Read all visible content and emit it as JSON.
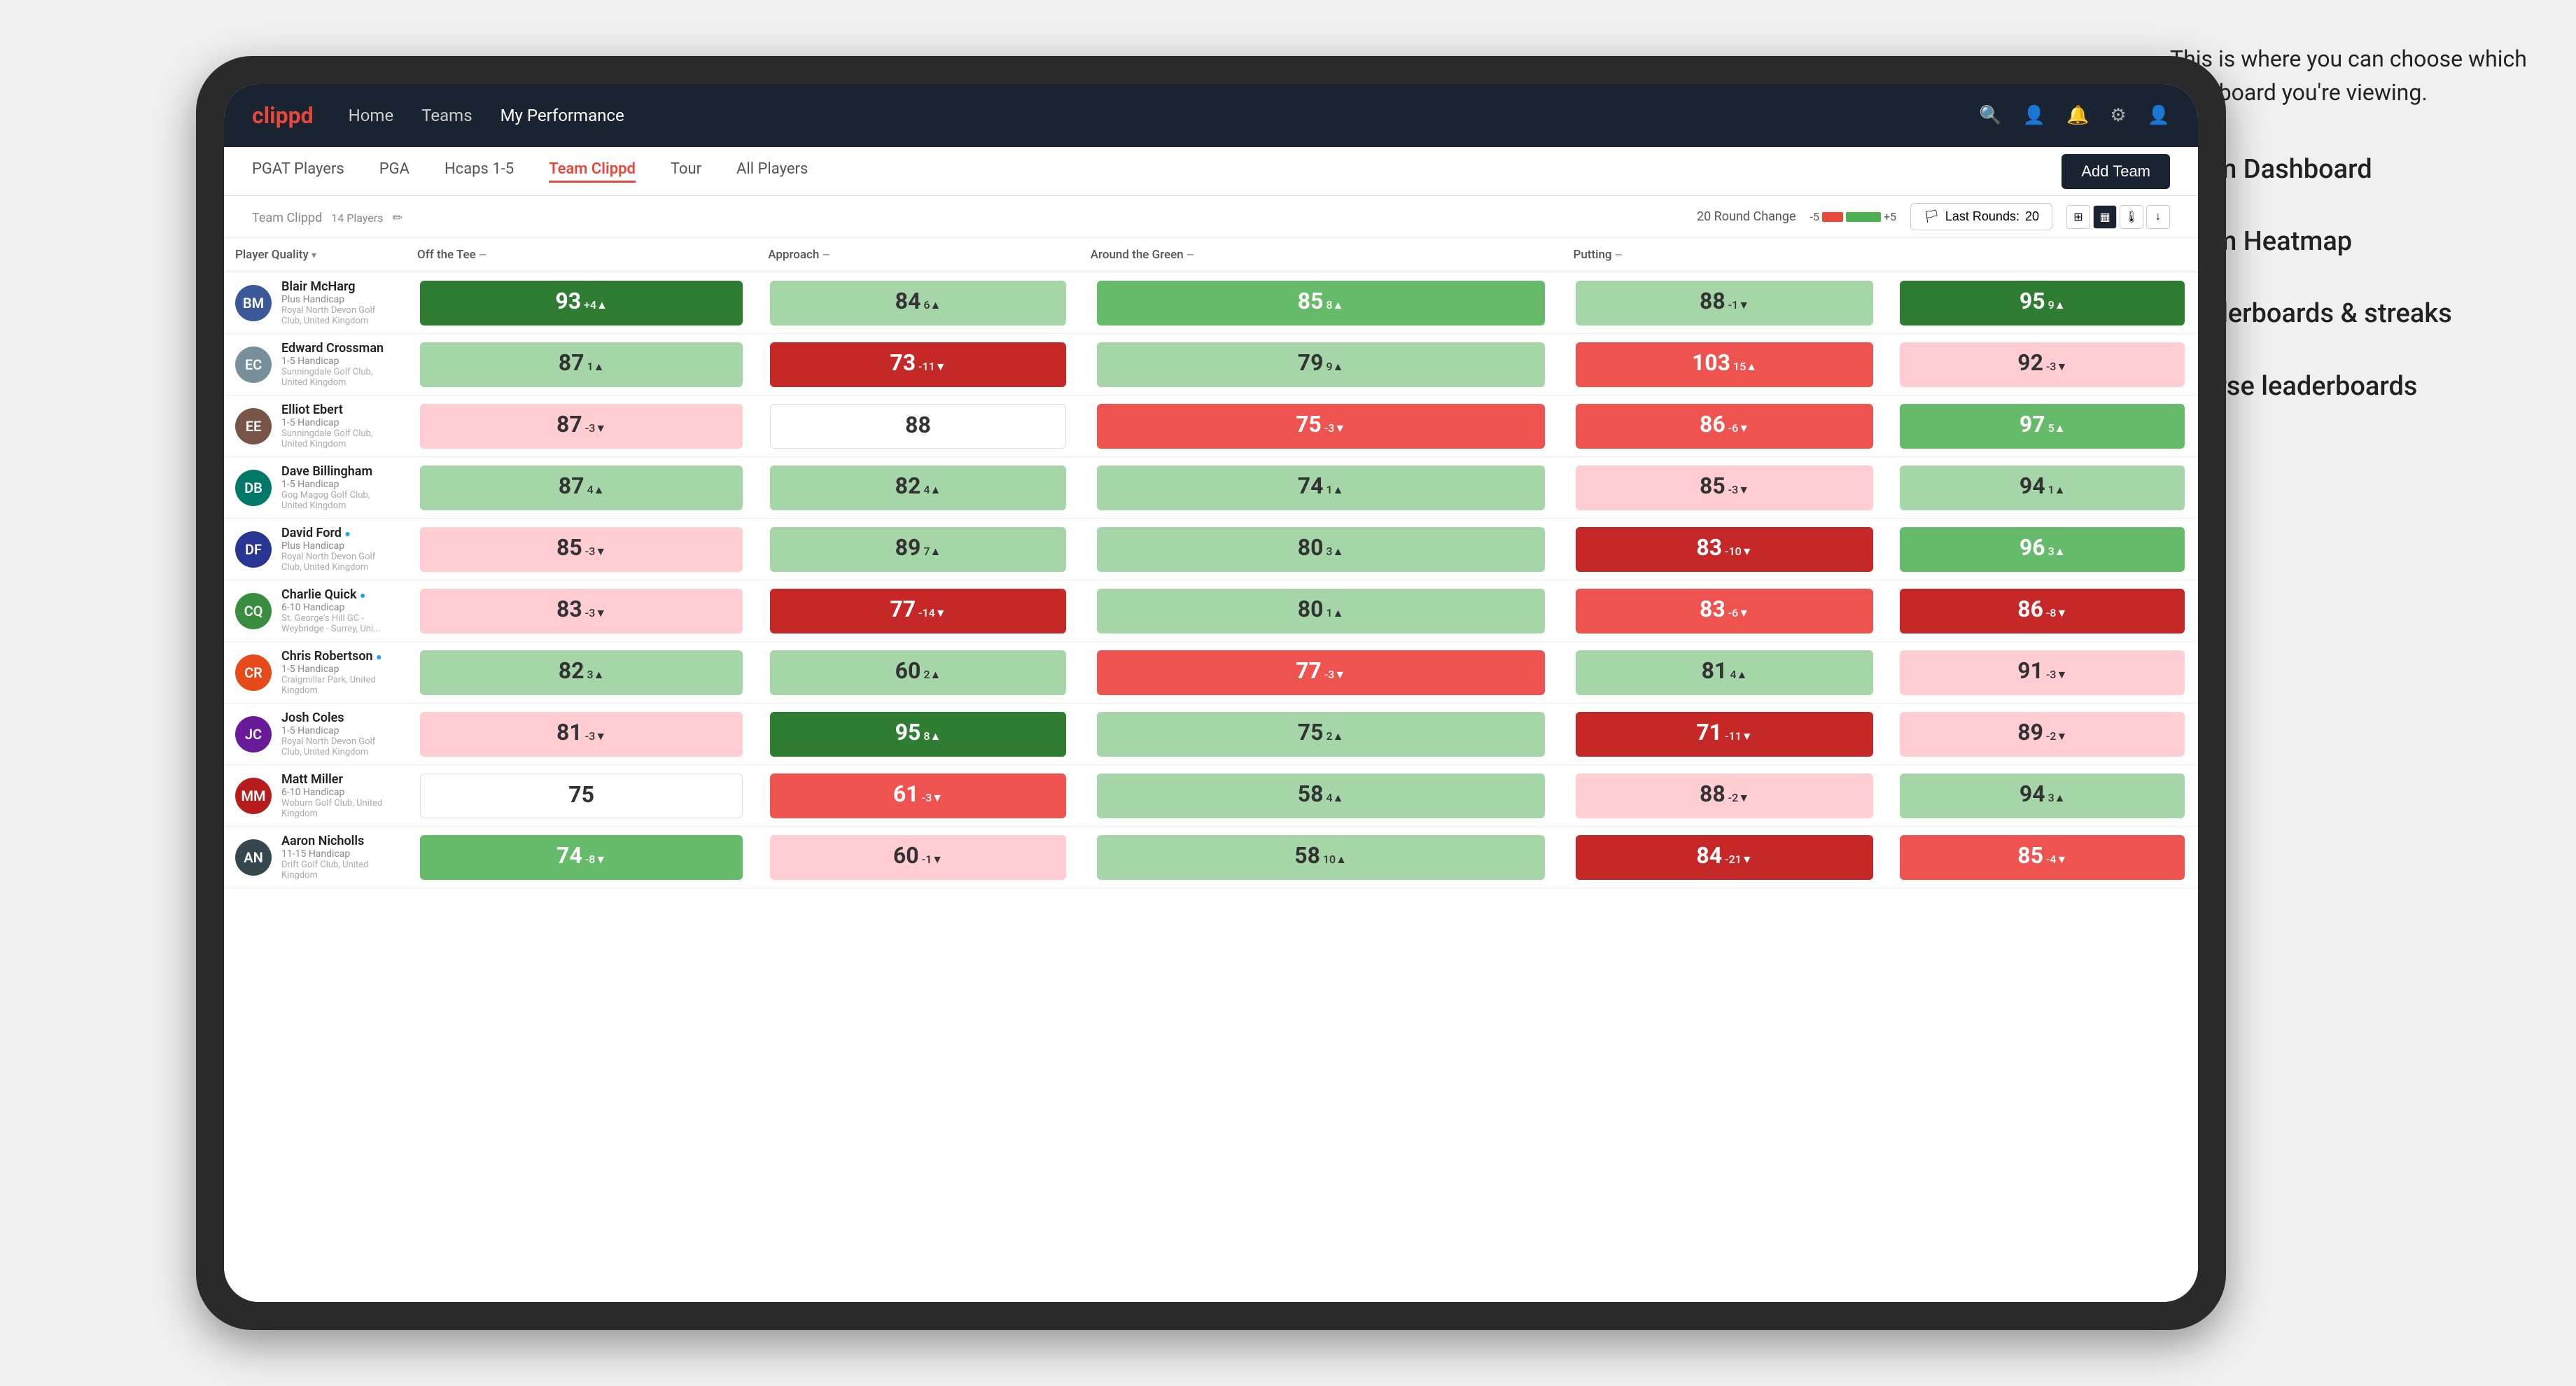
{
  "annotation": {
    "intro": "This is where you can choose which dashboard you're viewing.",
    "items": [
      "Team Dashboard",
      "Team Heatmap",
      "Leaderboards & streaks",
      "Course leaderboards"
    ]
  },
  "nav": {
    "logo": "clippd",
    "links": [
      "Home",
      "Teams",
      "My Performance"
    ],
    "active_link": "My Performance"
  },
  "sub_nav": {
    "links": [
      "PGAT Players",
      "PGA",
      "Hcaps 1-5",
      "Team Clippd",
      "Tour",
      "All Players"
    ],
    "active_link": "Team Clippd",
    "add_team_label": "Add Team"
  },
  "team_header": {
    "title": "Team Clippd",
    "player_count": "14 Players",
    "round_change_label": "20 Round Change",
    "change_min": "-5",
    "change_max": "+5",
    "last_rounds_label": "Last Rounds:",
    "last_rounds_value": "20"
  },
  "table": {
    "columns": {
      "player": "Player Quality",
      "off_tee": "Off the Tee",
      "approach": "Approach",
      "around_green": "Around the Green",
      "putting": "Putting"
    },
    "rows": [
      {
        "name": "Blair McHarg",
        "handicap": "Plus Handicap",
        "club": "Royal North Devon Golf Club, United Kingdom",
        "avatar_initials": "BM",
        "avatar_class": "av-blue",
        "player_quality": {
          "value": 93,
          "change": "+4",
          "direction": "up",
          "color": "green-dark"
        },
        "off_tee": {
          "value": 84,
          "change": "6",
          "direction": "up",
          "color": "green-light"
        },
        "approach": {
          "value": 85,
          "change": "8",
          "direction": "up",
          "color": "green-mid"
        },
        "around_green": {
          "value": 88,
          "change": "-1",
          "direction": "down",
          "color": "green-light"
        },
        "putting": {
          "value": 95,
          "change": "9",
          "direction": "up",
          "color": "green-dark"
        }
      },
      {
        "name": "Edward Crossman",
        "handicap": "1-5 Handicap",
        "club": "Sunningdale Golf Club, United Kingdom",
        "avatar_initials": "EC",
        "avatar_class": "av-gray",
        "player_quality": {
          "value": 87,
          "change": "1",
          "direction": "up",
          "color": "green-light"
        },
        "off_tee": {
          "value": 73,
          "change": "-11",
          "direction": "down",
          "color": "red-dark"
        },
        "approach": {
          "value": 79,
          "change": "9",
          "direction": "up",
          "color": "green-light"
        },
        "around_green": {
          "value": 103,
          "change": "15",
          "direction": "up",
          "color": "red-mid"
        },
        "putting": {
          "value": 92,
          "change": "-3",
          "direction": "down",
          "color": "red-light"
        }
      },
      {
        "name": "Elliot Ebert",
        "handicap": "1-5 Handicap",
        "club": "Sunningdale Golf Club, United Kingdom",
        "avatar_initials": "EE",
        "avatar_class": "av-brown",
        "player_quality": {
          "value": 87,
          "change": "-3",
          "direction": "down",
          "color": "red-light"
        },
        "off_tee": {
          "value": 88,
          "change": "",
          "direction": "none",
          "color": "white-box"
        },
        "approach": {
          "value": 75,
          "change": "-3",
          "direction": "down",
          "color": "red-mid"
        },
        "around_green": {
          "value": 86,
          "change": "-6",
          "direction": "down",
          "color": "red-mid"
        },
        "putting": {
          "value": 97,
          "change": "5",
          "direction": "up",
          "color": "green-mid"
        }
      },
      {
        "name": "Dave Billingham",
        "handicap": "1-5 Handicap",
        "club": "Gog Magog Golf Club, United Kingdom",
        "avatar_initials": "DB",
        "avatar_class": "av-teal",
        "player_quality": {
          "value": 87,
          "change": "4",
          "direction": "up",
          "color": "green-light"
        },
        "off_tee": {
          "value": 82,
          "change": "4",
          "direction": "up",
          "color": "green-light"
        },
        "approach": {
          "value": 74,
          "change": "1",
          "direction": "up",
          "color": "green-light"
        },
        "around_green": {
          "value": 85,
          "change": "-3",
          "direction": "down",
          "color": "red-light"
        },
        "putting": {
          "value": 94,
          "change": "1",
          "direction": "up",
          "color": "green-light"
        }
      },
      {
        "name": "David Ford",
        "handicap": "Plus Handicap",
        "club": "Royal North Devon Golf Club, United Kingdom",
        "avatar_initials": "DF",
        "avatar_class": "av-navy",
        "verified": true,
        "player_quality": {
          "value": 85,
          "change": "-3",
          "direction": "down",
          "color": "red-light"
        },
        "off_tee": {
          "value": 89,
          "change": "7",
          "direction": "up",
          "color": "green-light"
        },
        "approach": {
          "value": 80,
          "change": "3",
          "direction": "up",
          "color": "green-light"
        },
        "around_green": {
          "value": 83,
          "change": "-10",
          "direction": "down",
          "color": "red-dark"
        },
        "putting": {
          "value": 96,
          "change": "3",
          "direction": "up",
          "color": "green-mid"
        }
      },
      {
        "name": "Charlie Quick",
        "handicap": "6-10 Handicap",
        "club": "St. George's Hill GC - Weybridge - Surrey, Uni...",
        "avatar_initials": "CQ",
        "avatar_class": "av-green",
        "verified": true,
        "player_quality": {
          "value": 83,
          "change": "-3",
          "direction": "down",
          "color": "red-light"
        },
        "off_tee": {
          "value": 77,
          "change": "-14",
          "direction": "down",
          "color": "red-dark"
        },
        "approach": {
          "value": 80,
          "change": "1",
          "direction": "up",
          "color": "green-light"
        },
        "around_green": {
          "value": 83,
          "change": "-6",
          "direction": "down",
          "color": "red-mid"
        },
        "putting": {
          "value": 86,
          "change": "-8",
          "direction": "down",
          "color": "red-dark"
        }
      },
      {
        "name": "Chris Robertson",
        "handicap": "1-5 Handicap",
        "club": "Craigmillar Park, United Kingdom",
        "avatar_initials": "CR",
        "avatar_class": "av-orange",
        "verified": true,
        "player_quality": {
          "value": 82,
          "change": "3",
          "direction": "up",
          "color": "green-light"
        },
        "off_tee": {
          "value": 60,
          "change": "2",
          "direction": "up",
          "color": "green-light"
        },
        "approach": {
          "value": 77,
          "change": "-3",
          "direction": "down",
          "color": "red-mid"
        },
        "around_green": {
          "value": 81,
          "change": "4",
          "direction": "up",
          "color": "green-light"
        },
        "putting": {
          "value": 91,
          "change": "-3",
          "direction": "down",
          "color": "red-light"
        }
      },
      {
        "name": "Josh Coles",
        "handicap": "1-5 Handicap",
        "club": "Royal North Devon Golf Club, United Kingdom",
        "avatar_initials": "JC",
        "avatar_class": "av-purple",
        "player_quality": {
          "value": 81,
          "change": "-3",
          "direction": "down",
          "color": "red-light"
        },
        "off_tee": {
          "value": 95,
          "change": "8",
          "direction": "up",
          "color": "green-dark"
        },
        "approach": {
          "value": 75,
          "change": "2",
          "direction": "up",
          "color": "green-light"
        },
        "around_green": {
          "value": 71,
          "change": "-11",
          "direction": "down",
          "color": "red-dark"
        },
        "putting": {
          "value": 89,
          "change": "-2",
          "direction": "down",
          "color": "red-light"
        }
      },
      {
        "name": "Matt Miller",
        "handicap": "6-10 Handicap",
        "club": "Woburn Golf Club, United Kingdom",
        "avatar_initials": "MM",
        "avatar_class": "av-red",
        "player_quality": {
          "value": 75,
          "change": "",
          "direction": "none",
          "color": "white-box"
        },
        "off_tee": {
          "value": 61,
          "change": "-3",
          "direction": "down",
          "color": "red-mid"
        },
        "approach": {
          "value": 58,
          "change": "4",
          "direction": "up",
          "color": "green-light"
        },
        "around_green": {
          "value": 88,
          "change": "-2",
          "direction": "down",
          "color": "red-light"
        },
        "putting": {
          "value": 94,
          "change": "3",
          "direction": "up",
          "color": "green-light"
        }
      },
      {
        "name": "Aaron Nicholls",
        "handicap": "11-15 Handicap",
        "club": "Drift Golf Club, United Kingdom",
        "avatar_initials": "AN",
        "avatar_class": "av-dark",
        "player_quality": {
          "value": 74,
          "change": "-8",
          "direction": "down",
          "color": "green-mid"
        },
        "off_tee": {
          "value": 60,
          "change": "-1",
          "direction": "down",
          "color": "red-light"
        },
        "approach": {
          "value": 58,
          "change": "10",
          "direction": "up",
          "color": "green-light"
        },
        "around_green": {
          "value": 84,
          "change": "-21",
          "direction": "down",
          "color": "red-dark"
        },
        "putting": {
          "value": 85,
          "change": "-4",
          "direction": "down",
          "color": "red-mid"
        }
      }
    ]
  },
  "icons": {
    "search": "🔍",
    "person": "👤",
    "bell": "🔔",
    "gear": "⚙",
    "user_circle": "👤",
    "pencil": "✏",
    "grid": "⊞",
    "list": "☰",
    "download": "↓",
    "arrow_up": "▲",
    "arrow_down": "▼",
    "verified": "✓",
    "flag": "🏳"
  }
}
